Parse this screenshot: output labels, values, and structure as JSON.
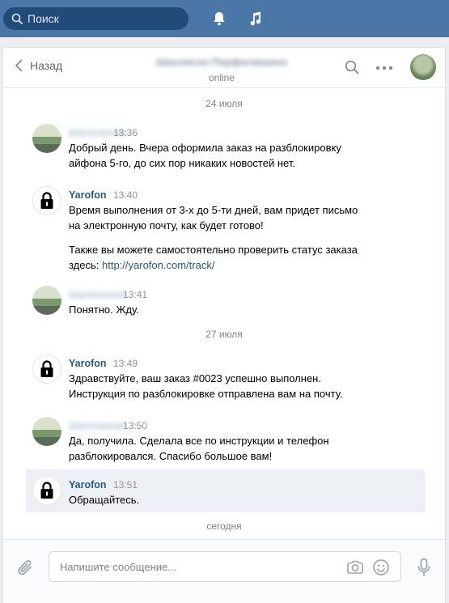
{
  "topbar": {
    "search_placeholder": "Поиск",
    "bell_icon": "bell-icon",
    "music_icon": "music-icon"
  },
  "header": {
    "back_label": "Назад",
    "contact_name": "Шахлиско Перфилишкно",
    "status": "online"
  },
  "history": {
    "dates": [
      "24 июля",
      "27 июля",
      "сегодня"
    ],
    "messages": [
      {
        "author": "Шалоскоска",
        "time": "13:36",
        "text": "Добрый день. Вчера оформила заказ на разблокировку",
        "text2": "айфона 5-го, до сих пор никаких новостей нет."
      },
      {
        "author": "Yarofon",
        "time": "13:40",
        "text": "Время выполнения от 3-х до 5-ти дней, вам придет письмо",
        "text2": "на электронную почту, как будет готово!",
        "text3": "Также вы можете самостоятельно проверить статус заказа",
        "text4_prefix": "здесь: ",
        "link": "http://yarofon.com/track/"
      },
      {
        "author": "Шалоскоска",
        "time": "13:41",
        "text": "Понятно. Жду."
      },
      {
        "author": "Yarofon",
        "time": "13:49",
        "text": "Здравствуйте, ваш заказ #0023 успешно выполнен.",
        "text2": "Инструкция по разблокировке отправлена вам на почту."
      },
      {
        "author": "Шалоскоска",
        "time": "13:50",
        "text": "Да, получила. Сделала все по инструкции и телефон",
        "text2": "разблокировался. Спасибо большое вам!"
      },
      {
        "author": "Yarofon",
        "time": "13:51",
        "text": "Обращайтесь."
      }
    ]
  },
  "composer": {
    "placeholder": "Напишите сообщение..."
  },
  "colors": {
    "brand": "#4a76a8",
    "link": "#2a5885",
    "selected_bg": "#edf0f5"
  }
}
